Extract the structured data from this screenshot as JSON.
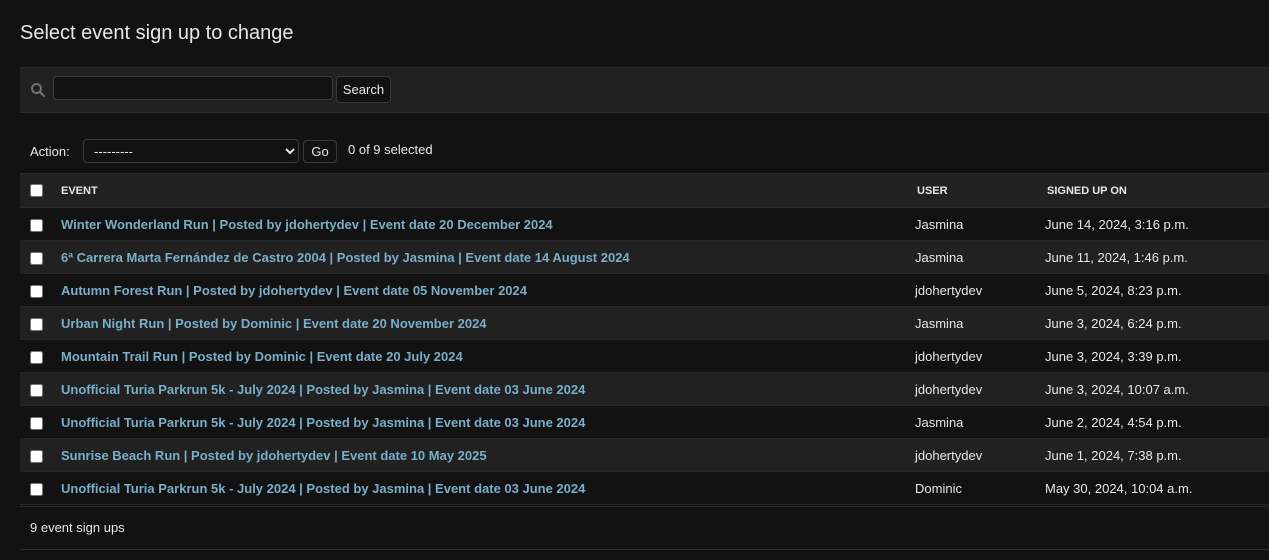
{
  "page": {
    "title": "Select event sign up to change"
  },
  "search": {
    "value": "",
    "placeholder": "",
    "button_label": "Search"
  },
  "actions": {
    "label": "Action:",
    "selected_option": "---------",
    "go_label": "Go",
    "selection_counter": "0 of 9 selected"
  },
  "table": {
    "columns": [
      "EVENT",
      "USER",
      "SIGNED UP ON"
    ],
    "rows": [
      {
        "event": "Winter Wonderland Run | Posted by jdohertydev | Event date 20 December 2024",
        "user": "Jasmina",
        "signed_up_on": "June 14, 2024, 3:16 p.m."
      },
      {
        "event": "6ª Carrera Marta Fernández de Castro 2004 | Posted by Jasmina | Event date 14 August 2024",
        "user": "Jasmina",
        "signed_up_on": "June 11, 2024, 1:46 p.m."
      },
      {
        "event": "Autumn Forest Run | Posted by jdohertydev | Event date 05 November 2024",
        "user": "jdohertydev",
        "signed_up_on": "June 5, 2024, 8:23 p.m."
      },
      {
        "event": "Urban Night Run | Posted by Dominic | Event date 20 November 2024",
        "user": "Jasmina",
        "signed_up_on": "June 3, 2024, 6:24 p.m."
      },
      {
        "event": "Mountain Trail Run | Posted by Dominic | Event date 20 July 2024",
        "user": "jdohertydev",
        "signed_up_on": "June 3, 2024, 3:39 p.m."
      },
      {
        "event": "Unofficial Turia Parkrun 5k - July 2024 | Posted by Jasmina | Event date 03 June 2024",
        "user": "jdohertydev",
        "signed_up_on": "June 3, 2024, 10:07 a.m."
      },
      {
        "event": "Unofficial Turia Parkrun 5k - July 2024 | Posted by Jasmina | Event date 03 June 2024",
        "user": "Jasmina",
        "signed_up_on": "June 2, 2024, 4:54 p.m."
      },
      {
        "event": "Sunrise Beach Run | Posted by jdohertydev | Event date 10 May 2025",
        "user": "jdohertydev",
        "signed_up_on": "June 1, 2024, 7:38 p.m."
      },
      {
        "event": "Unofficial Turia Parkrun 5k - July 2024 | Posted by Jasmina | Event date 03 June 2024",
        "user": "Dominic",
        "signed_up_on": "May 30, 2024, 10:04 a.m."
      }
    ]
  },
  "footer": {
    "result_count": "9 event sign ups"
  },
  "colors": {
    "background": "#121212",
    "bar": "#212121",
    "link": "#79aec8",
    "text": "#e7e7e7"
  },
  "icons": {
    "search": "search-icon"
  }
}
